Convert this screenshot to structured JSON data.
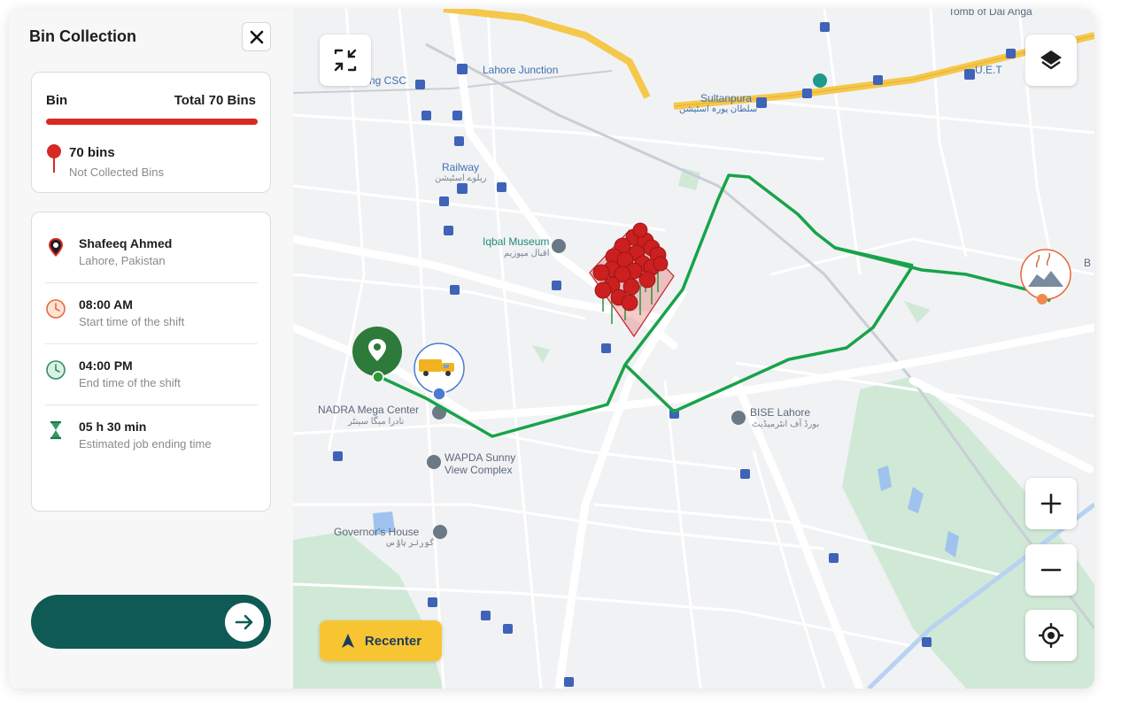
{
  "panel": {
    "title": "Bin Collection",
    "bin_summary": {
      "label": "Bin",
      "total": "Total 70 Bins",
      "count": "70 bins",
      "status": "Not Collected Bins",
      "bar_color": "#d62a22"
    },
    "driver": {
      "name": "Shafeeq Ahmed",
      "location": "Lahore, Pakistan"
    },
    "shift": [
      {
        "icon": "clock-orange-icon",
        "value": "08:00 AM",
        "label": "Start time of the shift"
      },
      {
        "icon": "clock-green-icon",
        "value": "04:00 PM",
        "label": "End time of the shift"
      },
      {
        "icon": "hourglass-icon",
        "value": "05 h 30 min",
        "label": "Estimated job ending time"
      }
    ],
    "action": {
      "icon": "arrow-right-icon",
      "color": "#0f5a55"
    }
  },
  "map": {
    "labels": [
      {
        "text": "Lahore Junction",
        "kind": "transit"
      },
      {
        "text": "ng CSC",
        "kind": "transit"
      },
      {
        "text": "Railway",
        "kind": "transit"
      },
      {
        "text": "ریلوے اسٹیشن",
        "kind": "urdu"
      },
      {
        "text": "Iqbal Museum",
        "kind": "poi"
      },
      {
        "text": "اقبال میوزیم",
        "kind": "urdu"
      },
      {
        "text": "Sultanpura",
        "kind": "transit"
      },
      {
        "text": "سلطان پورہ اسٹیشن",
        "kind": "urdu"
      },
      {
        "text": "U.E.T",
        "kind": "transit"
      },
      {
        "text": "NADRA Mega Center",
        "kind": "poi"
      },
      {
        "text": "نادرا میگا سینٹر",
        "kind": "urdu"
      },
      {
        "text": "BISE Lahore",
        "kind": "poi"
      },
      {
        "text": "بورڈ آف انٹرمیڈیٹ",
        "kind": "urdu"
      },
      {
        "text": "WAPDA Sunny",
        "kind": "poi"
      },
      {
        "text": "View Complex",
        "kind": "poi"
      },
      {
        "text": "Governor's House",
        "kind": "poi"
      },
      {
        "text": "گورنر ہاؤس",
        "kind": "urdu"
      },
      {
        "text": "Tomb of Dai Anga",
        "kind": "poi"
      },
      {
        "text": "B",
        "kind": "poi"
      }
    ],
    "route_color": "#18a34a",
    "bin_marker_color": "#cc1f1f",
    "recenter_label": "Recenter",
    "recenter_color": "#f7c532",
    "controls": [
      "collapse-icon",
      "layers-icon",
      "zoom-in-icon",
      "zoom-out-icon",
      "my-location-icon"
    ]
  }
}
